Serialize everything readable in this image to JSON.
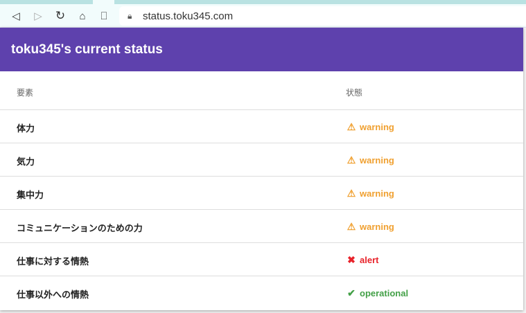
{
  "browser": {
    "url": "status.toku345.com"
  },
  "page": {
    "title": "toku345's current status",
    "columns": [
      "要素",
      "状態"
    ],
    "rows": [
      {
        "name": "体力",
        "status": "warning",
        "icon": "warning-icon",
        "color": "#f0a030"
      },
      {
        "name": "気力",
        "status": "warning",
        "icon": "warning-icon",
        "color": "#f0a030"
      },
      {
        "name": "集中力",
        "status": "warning",
        "icon": "warning-icon",
        "color": "#f0a030"
      },
      {
        "name": "コミュニケーションのための力",
        "status": "warning",
        "icon": "warning-icon",
        "color": "#f0a030"
      },
      {
        "name": "仕事に対する情熱",
        "status": "alert",
        "icon": "close-icon",
        "color": "#e8222a"
      },
      {
        "name": "仕事以外への情熱",
        "status": "operational",
        "icon": "check-icon",
        "color": "#43a047"
      }
    ]
  }
}
